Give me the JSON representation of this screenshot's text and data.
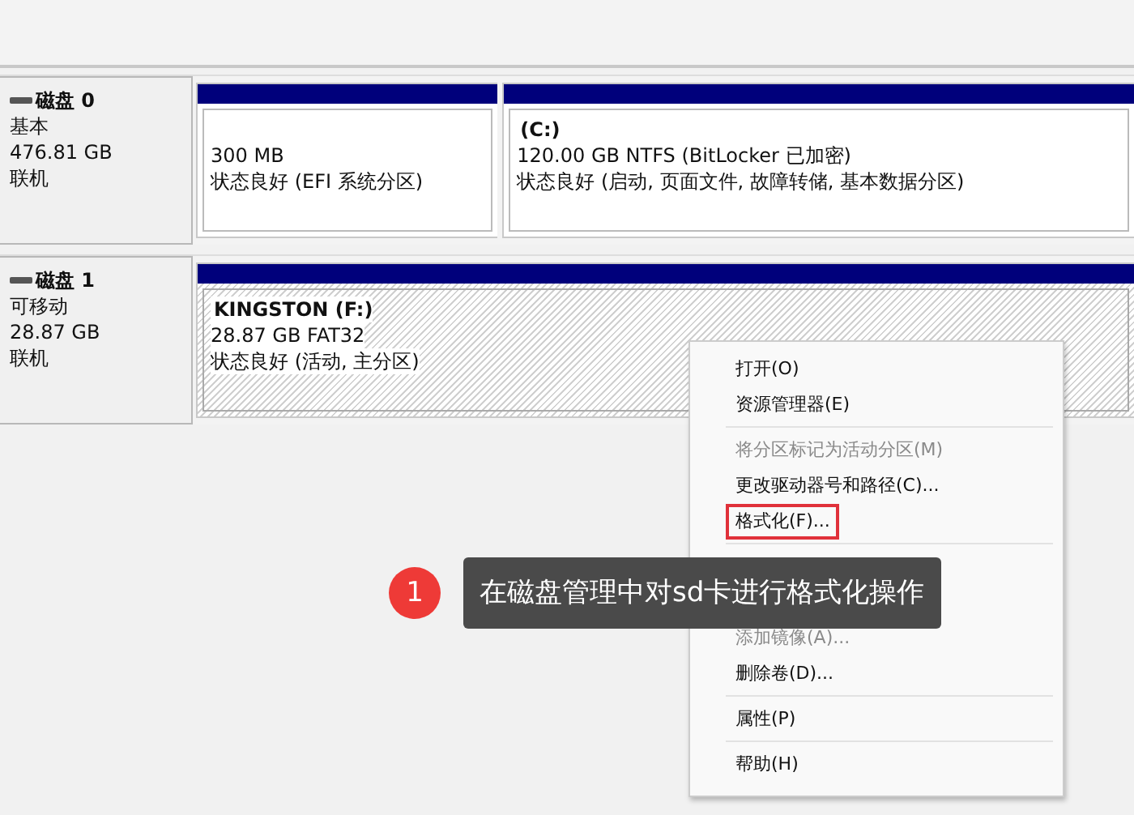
{
  "disks": [
    {
      "name": "磁盘 0",
      "type": "基本",
      "size": "476.81 GB",
      "status": "联机",
      "partitions": [
        {
          "size_fs": "300 MB",
          "health": "状态良好 (EFI 系统分区)",
          "hatched": false
        },
        {
          "label": "(C:)",
          "size_fs": "120.00 GB NTFS (BitLocker 已加密)",
          "health": "状态良好 (启动, 页面文件, 故障转储, 基本数据分区)",
          "hatched": false
        }
      ]
    },
    {
      "name": "磁盘 1",
      "type": "可移动",
      "size": "28.87 GB",
      "status": "联机",
      "partitions": [
        {
          "label": "KINGSTON  (F:)",
          "size_fs": "28.87 GB FAT32",
          "health": "状态良好 (活动, 主分区)",
          "hatched": true
        }
      ]
    }
  ],
  "context_menu": [
    {
      "kind": "item",
      "label": "打开(O)",
      "disabled": false,
      "highlighted": false
    },
    {
      "kind": "item",
      "label": "资源管理器(E)",
      "disabled": false,
      "highlighted": false
    },
    {
      "kind": "separator"
    },
    {
      "kind": "item",
      "label": "将分区标记为活动分区(M)",
      "disabled": true,
      "highlighted": false
    },
    {
      "kind": "item",
      "label": "更改驱动器号和路径(C)...",
      "disabled": false,
      "highlighted": false
    },
    {
      "kind": "item",
      "label": "格式化(F)...",
      "disabled": false,
      "highlighted": true
    },
    {
      "kind": "separator"
    },
    {
      "kind": "covered"
    },
    {
      "kind": "covered"
    },
    {
      "kind": "item",
      "label": "添加镜像(A)...",
      "disabled": true,
      "highlighted": false
    },
    {
      "kind": "item",
      "label": "删除卷(D)...",
      "disabled": false,
      "highlighted": false
    },
    {
      "kind": "separator"
    },
    {
      "kind": "item",
      "label": "属性(P)",
      "disabled": false,
      "highlighted": false
    },
    {
      "kind": "separator"
    },
    {
      "kind": "item",
      "label": "帮助(H)",
      "disabled": false,
      "highlighted": false
    }
  ],
  "callout": {
    "number": "1",
    "text": "在磁盘管理中对sd卡进行格式化操作"
  }
}
